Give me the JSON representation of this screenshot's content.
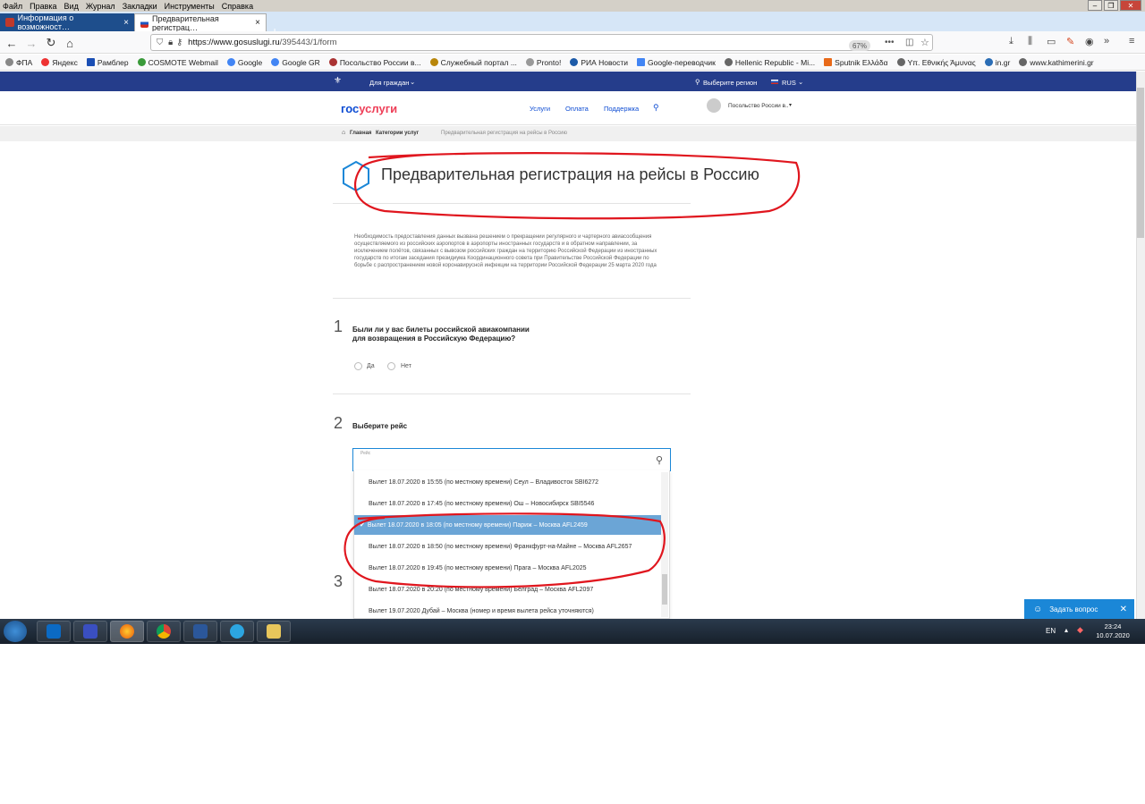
{
  "menubar": {
    "items": [
      "Файл",
      "Правка",
      "Вид",
      "Журнал",
      "Закладки",
      "Инструменты",
      "Справка"
    ]
  },
  "tabs": [
    {
      "label": "Информация о возможност…",
      "active": false
    },
    {
      "label": "Предварительная регистрац…",
      "active": true
    }
  ],
  "address_bar": {
    "url_host": "https://www.gosuslugi.ru",
    "url_path": "/395443/1/form",
    "zoom": "67%"
  },
  "bookmarks": [
    "ФПА",
    "Яндекс",
    "Рамблер",
    "COSMOTE Webmail",
    "Google",
    "Google GR",
    "Посольство России в...",
    "Служебный портал ...",
    "Pronto!",
    "РИА Новости",
    "Google-переводчик",
    "Hellenic Republic - Mi...",
    "Sputnik Ελλάδα",
    "Υπ. Εθνικής Άμυνας",
    "in.gr",
    "www.kathimerini.gr"
  ],
  "gov_top": {
    "for_citizens": "Для граждан",
    "region": "Выберите регион",
    "lang": "RUS"
  },
  "header": {
    "logo_a": "гос",
    "logo_b": "услуги",
    "nav": [
      "Услуги",
      "Оплата",
      "Поддержка"
    ],
    "user": "Посольство России в.."
  },
  "breadcrumb": [
    "Главная",
    "Категории услуг",
    "Предварительная регистрация на рейсы в Россию"
  ],
  "title": "Предварительная регистрация на рейсы в Россию",
  "description": "Необходимость предоставления данных вызвана решением о прекращении регулярного и чартерного авиасообщения осуществляемого из российских аэропортов в аэропорты иностранных государств и в обратном направлении, за исключением полётов, связанных с вывозом российских граждан на территорию Российской Федерации из иностранных государств по итогам заседания президиума Координационного совета при Правительстве Российской Федерации по борьбе с распространением новой коронавирусной инфекции на территории Российской Федерации 25 марта 2020 года",
  "q1": {
    "num": "1",
    "text": "Были ли у вас билеты российской авиакомпании для возвращения в Российскую Федерацию?",
    "yes": "Да",
    "no": "Нет"
  },
  "q2": {
    "num": "2",
    "text": "Выберите рейс",
    "field_label": "Рейс",
    "options": [
      "Вылет 18.07.2020 в 15:55 (по местному времени) Сеул – Владивосток SBI6272",
      "Вылет 18.07.2020 в 17:45 (по местному времени) Ош – Новосибирск SBI5546",
      "Вылет 18.07.2020 в 18:05 (по местному времени) Париж – Москва AFL2459",
      "Вылет 18.07.2020 в 18:50 (по местному времени) Франкфурт-на-Майне – Москва AFL2657",
      "Вылет 18.07.2020 в 19:45 (по местному времени) Прага – Москва AFL2025",
      "Вылет 18.07.2020 в 20:20 (по местному времени) Белград – Москва AFL2097",
      "Вылет 19.07.2020 Дубай – Москва (номер и время вылета рейса уточняются)"
    ],
    "selected_index": 2,
    "check": "✔"
  },
  "q3": {
    "num": "3"
  },
  "ask_button": "Задать вопрос",
  "taskbar": {
    "lang": "EN",
    "time": "23:24",
    "date": "10.07.2020"
  },
  "colors": {
    "gov_blue": "#253d8b",
    "link_blue": "#0d4cd3",
    "logo_red": "#ee3f58",
    "selected_option": "#6ba5d6",
    "annotation_red": "#e0161e"
  }
}
